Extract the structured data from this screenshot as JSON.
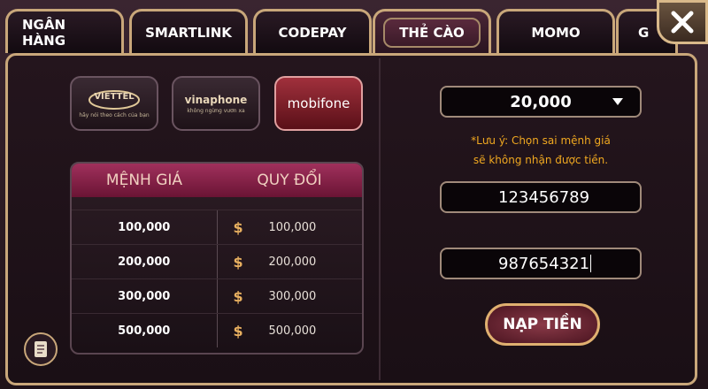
{
  "tabs": [
    {
      "label": "NGÂN HÀNG"
    },
    {
      "label": "SMARTLINK"
    },
    {
      "label": "CODEPAY"
    },
    {
      "label": "THẺ CÀO",
      "active": true
    },
    {
      "label": "MOMO"
    },
    {
      "label": "G"
    }
  ],
  "providers": [
    {
      "name": "VIETTEL",
      "sub": "hãy nói theo cách của bạn"
    },
    {
      "name": "vinaphone",
      "sub": "không ngừng vươn xa"
    },
    {
      "name": "mobifone",
      "sub": "",
      "selected": true
    }
  ],
  "table": {
    "headers": [
      "MỆNH GIÁ",
      "QUY ĐỔI"
    ],
    "rows": [
      {
        "value": "100,000",
        "exchange": "100,000"
      },
      {
        "value": "200,000",
        "exchange": "200,000"
      },
      {
        "value": "300,000",
        "exchange": "300,000"
      },
      {
        "value": "500,000",
        "exchange": "500,000"
      }
    ],
    "currency": "$"
  },
  "form": {
    "denomination": "20,000",
    "note_line1": "*Lưu ý: Chọn sai mệnh giá",
    "note_line2": "sẽ không nhận được tiền.",
    "serial": "123456789",
    "pin": "987654321",
    "submit": "NẠP TIỀN"
  },
  "colors": {
    "accent": "#c9a77a",
    "selected": "#a0303c",
    "note": "#f0a820"
  }
}
